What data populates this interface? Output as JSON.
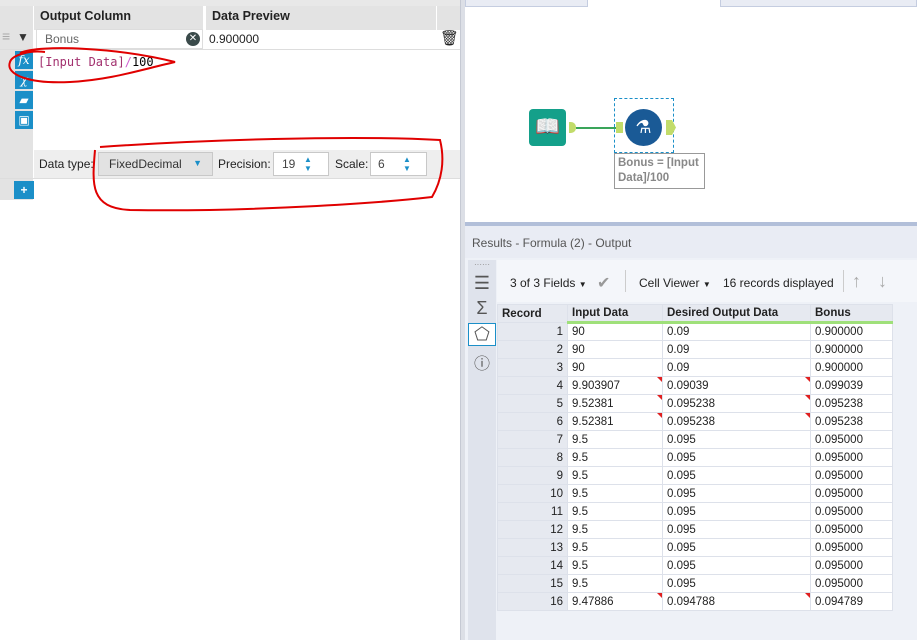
{
  "formula_panel": {
    "headers": {
      "output_column": "Output Column",
      "data_preview": "Data Preview"
    },
    "row": {
      "output_column": "Bonus",
      "data_preview": "0.900000"
    },
    "expression": {
      "field": "[Input Data]",
      "operator": "/",
      "number": "100"
    },
    "data_type_label": "Data type:",
    "data_type_value": "FixedDecimal",
    "precision_label": "Precision:",
    "precision_value": "19",
    "scale_label": "Scale:",
    "scale_value": "6",
    "add_label": "+"
  },
  "canvas": {
    "tool_annotation": "Bonus = [Input Data]/100"
  },
  "results": {
    "title": "Results - Formula (2) - Output",
    "fields_label": "3 of 3 Fields",
    "cell_viewer_label": "Cell Viewer",
    "records_label": "16 records displayed",
    "columns": [
      "Record",
      "Input Data",
      "Desired Output Data",
      "Bonus"
    ],
    "rows": [
      [
        "1",
        "90",
        "0.09",
        "0.900000",
        false
      ],
      [
        "2",
        "90",
        "0.09",
        "0.900000",
        false
      ],
      [
        "3",
        "90",
        "0.09",
        "0.900000",
        false
      ],
      [
        "4",
        "9.903907",
        "0.09039",
        "0.099039",
        true
      ],
      [
        "5",
        "9.52381",
        "0.095238",
        "0.095238",
        true
      ],
      [
        "6",
        "9.52381",
        "0.095238",
        "0.095238",
        true
      ],
      [
        "7",
        "9.5",
        "0.095",
        "0.095000",
        false
      ],
      [
        "8",
        "9.5",
        "0.095",
        "0.095000",
        false
      ],
      [
        "9",
        "9.5",
        "0.095",
        "0.095000",
        false
      ],
      [
        "10",
        "9.5",
        "0.095",
        "0.095000",
        false
      ],
      [
        "11",
        "9.5",
        "0.095",
        "0.095000",
        false
      ],
      [
        "12",
        "9.5",
        "0.095",
        "0.095000",
        false
      ],
      [
        "13",
        "9.5",
        "0.095",
        "0.095000",
        false
      ],
      [
        "14",
        "9.5",
        "0.095",
        "0.095000",
        false
      ],
      [
        "15",
        "9.5",
        "0.095",
        "0.095000",
        false
      ],
      [
        "16",
        "9.47886",
        "0.094788",
        "0.094789",
        true
      ]
    ]
  },
  "colors": {
    "accent": "#1b8fc8",
    "annotation": "#e00000",
    "connector": "#c2dc6a",
    "input_tool": "#14a08a",
    "formula_tool": "#1a5a96"
  }
}
